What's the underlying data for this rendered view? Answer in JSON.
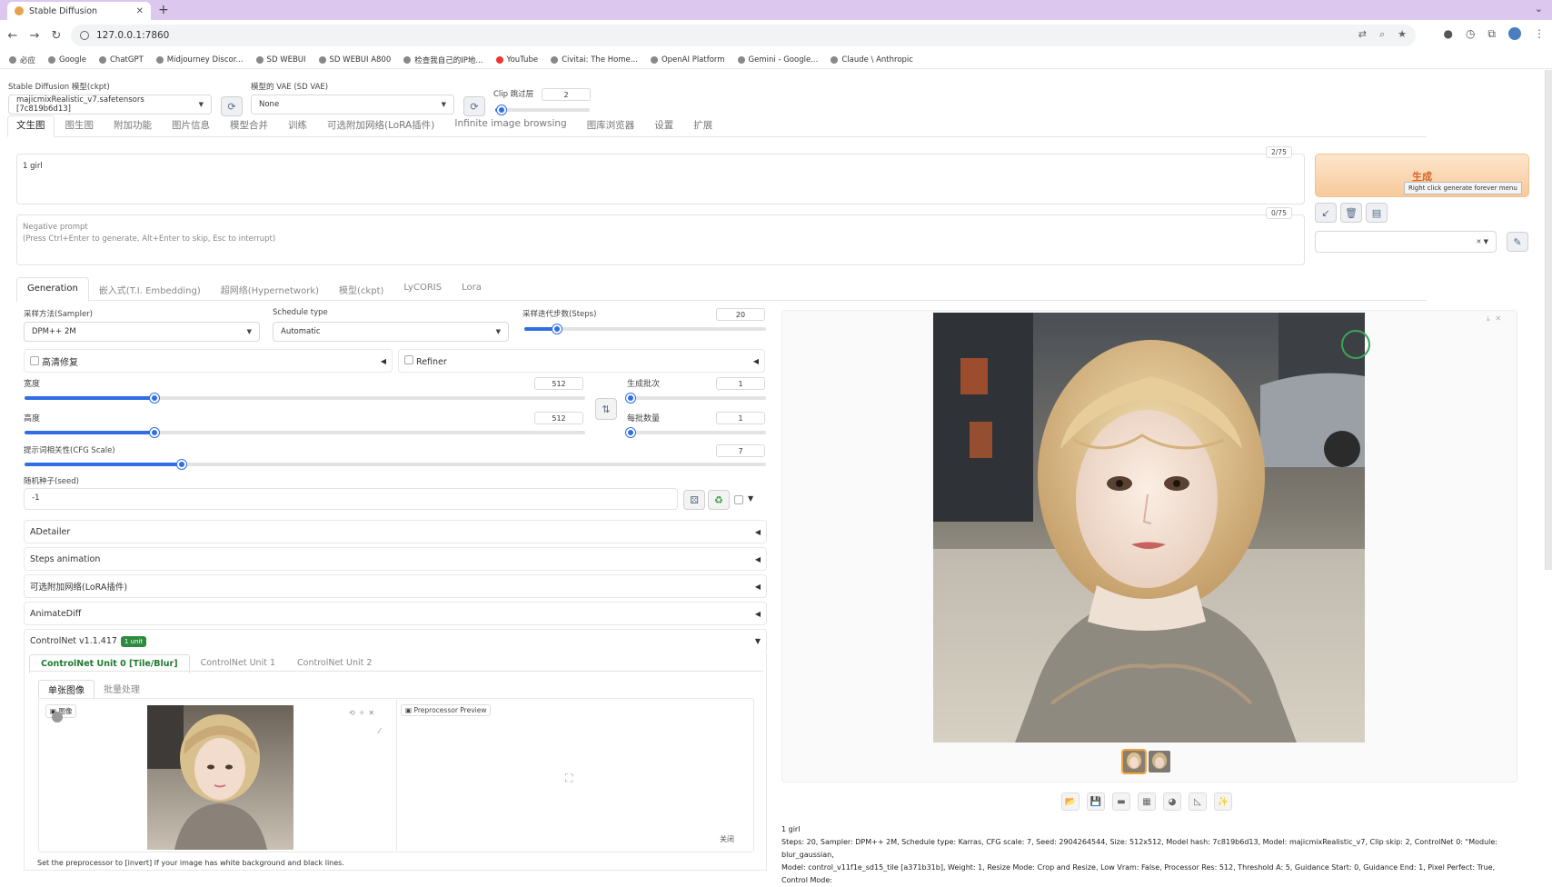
{
  "browser": {
    "tab_title": "Stable Diffusion",
    "url": "127.0.0.1:7860",
    "bookmarks": [
      "必应",
      "Google",
      "ChatGPT",
      "Midjourney Discor...",
      "SD WEBUI",
      "SD WEBUI A800",
      "检查我自己的IP地...",
      "YouTube",
      "Civitai: The Home...",
      "OpenAI Platform",
      "Gemini - Google...",
      "Claude \\ Anthropic"
    ]
  },
  "top": {
    "ckpt_label": "Stable Diffusion 模型(ckpt)",
    "ckpt_value": "majicmixRealistic_v7.safetensors [7c819b6d13]",
    "vae_label": "模型的 VAE (SD VAE)",
    "vae_value": "None",
    "clip_label": "Clip 跳过层",
    "clip_value": "2"
  },
  "main_tabs": [
    "文生图",
    "图生图",
    "附加功能",
    "图片信息",
    "模型合并",
    "训练",
    "可选附加网络(LoRA插件)",
    "Infinite image browsing",
    "图库浏览器",
    "设置",
    "扩展"
  ],
  "prompt": {
    "positive": "1 girl",
    "positive_count": "2/75",
    "negative_placeholder": "Negative prompt",
    "negative_hint": "(Press Ctrl+Enter to generate, Alt+Enter to skip, Esc to interrupt)",
    "negative_count": "0/75"
  },
  "generate": {
    "label": "生成",
    "tooltip": "Right click generate forever menu"
  },
  "sub_tabs": [
    "Generation",
    "嵌入式(T.I. Embedding)",
    "超网络(Hypernetwork)",
    "模型(ckpt)",
    "LyCORIS",
    "Lora"
  ],
  "params": {
    "sampler_label": "采样方法(Sampler)",
    "sampler_value": "DPM++ 2M",
    "schedule_label": "Schedule type",
    "schedule_value": "Automatic",
    "steps_label": "采样迭代步数(Steps)",
    "steps_value": "20",
    "hires_label": "高清修复",
    "refiner_label": "Refiner",
    "width_label": "宽度",
    "width_value": "512",
    "height_label": "高度",
    "height_value": "512",
    "batch_count_label": "生成批次",
    "batch_count_value": "1",
    "batch_size_label": "每批数量",
    "batch_size_value": "1",
    "cfg_label": "提示词相关性(CFG Scale)",
    "cfg_value": "7",
    "seed_label": "随机种子(seed)",
    "seed_value": "-1"
  },
  "accordions": [
    "ADetailer",
    "Steps animation",
    "可选附加网络(LoRA插件)",
    "AnimateDiff"
  ],
  "controlnet": {
    "title": "ControlNet v1.1.417",
    "badge": "1 unit",
    "units": [
      "ControlNet Unit 0 [Tile/Blur]",
      "ControlNet Unit 1",
      "ControlNet Unit 2"
    ],
    "mode_tabs": [
      "单张图像",
      "批量处理"
    ],
    "image_label": "图像",
    "preview_label": "Preprocessor Preview",
    "close_label": "关闭",
    "hint": "Set the preprocessor to [invert] If your image has white background and black lines."
  },
  "output": {
    "prompt": "1 girl",
    "params_line1": "Steps: 20, Sampler: DPM++ 2M, Schedule type: Karras, CFG scale: 7, Seed: 2904264544, Size: 512x512, Model hash: 7c819b6d13, Model: majicmixRealistic_v7, Clip skip: 2, ControlNet 0: \"Module: blur_gaussian,",
    "params_line2": "Model: control_v11f1e_sd15_tile [a371b31b], Weight: 1, Resize Mode: Crop and Resize, Low Vram: False, Processor Res: 512, Threshold A: 5, Guidance Start: 0, Guidance End: 1, Pixel Perfect: True, Control Mode:"
  }
}
